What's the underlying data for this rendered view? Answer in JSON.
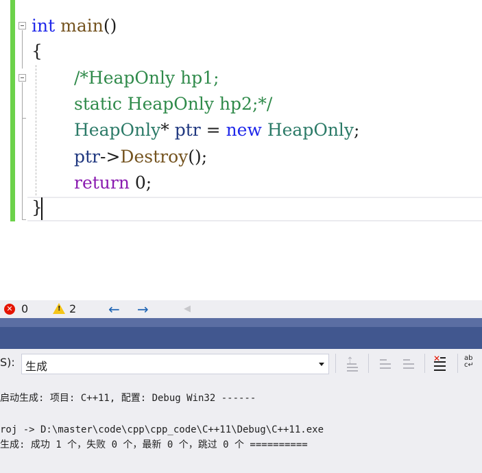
{
  "editor": {
    "code": {
      "line1": {
        "kw": "int",
        "fn": "main",
        "punct": "()"
      },
      "line2": {
        "brace": "{"
      },
      "line3": {
        "comment": "/*HeapOnly hp1;"
      },
      "line4": {
        "comment": "static HeapOnly hp2;*/"
      },
      "line5": {
        "type": "HeapOnly",
        "star": "*",
        "var": "ptr",
        "eq": "=",
        "kw": "new",
        "type2": "HeapOnly",
        "semi": ";"
      },
      "line6": {
        "var": "ptr",
        "arrow": "->",
        "fn": "Destroy",
        "rest": "();"
      },
      "line7": {
        "kw": "return",
        "rest": "0;"
      },
      "line8": {
        "brace": "}"
      }
    }
  },
  "statusbar": {
    "error_icon": "x-circle-icon",
    "error_glyph": "✕",
    "error_count": "0",
    "warning_icon": "warning-triangle-icon",
    "warning_glyph": "!",
    "warning_count": "2",
    "prev_glyph": "←",
    "next_glyph": "→",
    "left_scroll_glyph": "◀"
  },
  "output_panel": {
    "source_label": "S):",
    "source_value": "生成",
    "toolbar_icons": [
      "goto-prev-message-icon",
      "find-prev-icon",
      "find-next-icon",
      "clear-all-icon",
      "word-wrap-icon"
    ],
    "clear_glyph": "✕",
    "wrap_glyph_top": "ab",
    "wrap_glyph_bottom": "c↵",
    "lines": [
      "启动生成: 项目: C++11, 配置: Debug Win32 ------",
      "",
      "roj -> D:\\master\\code\\cpp\\cpp_code\\C++11\\Debug\\C++11.exe",
      "生成: 成功 1 个，失败 0 个，最新 0 个，跳过 0 个 =========="
    ]
  },
  "colors": {
    "change_bar": "#6cd24a",
    "keyword": "#1f27ea",
    "control_keyword": "#8a1bb0",
    "function": "#74531f",
    "type": "#2b7a67",
    "variable": "#1f377f",
    "comment": "#2f8a4a",
    "panel_title": "#41578f",
    "error": "#e51400",
    "warning": "#f5c518"
  }
}
